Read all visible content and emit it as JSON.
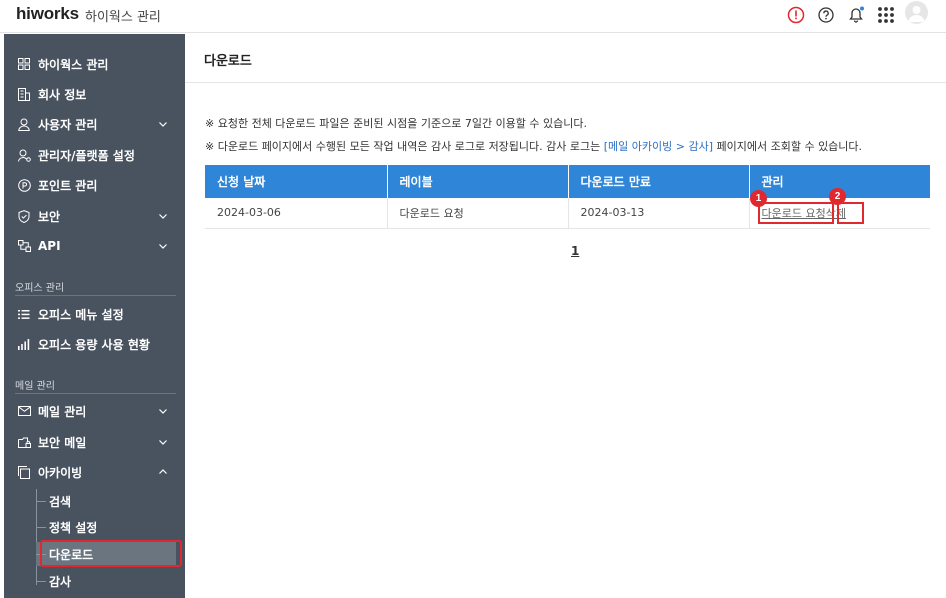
{
  "header": {
    "logo": "hiworks",
    "subtitle": "하이웍스 관리",
    "icons": [
      "alert-icon",
      "help-icon",
      "bell-icon",
      "apps-grid-icon",
      "avatar"
    ],
    "accent_red": "#e0282e"
  },
  "sidebar": {
    "items": [
      {
        "label": "하이웍스 관리",
        "icon": "grid-icon"
      },
      {
        "label": "회사 정보",
        "icon": "building-icon"
      },
      {
        "label": "사용자 관리",
        "icon": "user-icon"
      },
      {
        "label": "관리자/플랫폼 설정",
        "icon": "admin-user-icon"
      },
      {
        "label": "포인트 관리",
        "icon": "point-icon"
      },
      {
        "label": "보안",
        "icon": "shield-icon"
      },
      {
        "label": "API",
        "icon": "api-icon"
      }
    ],
    "office_section": "오피스 관리",
    "office_items": [
      {
        "label": "오피스 메뉴 설정",
        "icon": "list-icon"
      },
      {
        "label": "오피스 용량 사용 현황",
        "icon": "bar-chart-icon"
      }
    ],
    "mail_section": "메일 관리",
    "mail_items": [
      {
        "label": "메일 관리",
        "icon": "mail-icon"
      },
      {
        "label": "보안 메일",
        "icon": "secure-mail-icon"
      },
      {
        "label": "아카이빙",
        "icon": "archive-icon"
      }
    ],
    "archive_sub": [
      {
        "label": "검색"
      },
      {
        "label": "정책 설정"
      },
      {
        "label": "다운로드",
        "active": true
      },
      {
        "label": "감사"
      }
    ],
    "bg_color": "#495360"
  },
  "main": {
    "title": "다운로드",
    "notice1": "※ 요청한 전체 다운로드 파일은 준비된 시점을 기준으로 7일간 이용할 수 있습니다.",
    "notice2_pre": "※ 다운로드 페이지에서 수행된 모든 작업 내역은 감사 로그로 저장됩니다. 감사 로그는 ",
    "notice2_link": "[메일 아카이빙 > 감사]",
    "notice2_post": " 페이지에서 조회할 수 있습니다.",
    "table": {
      "headers": [
        "신청 날짜",
        "레이블",
        "다운로드 만료",
        "관리"
      ],
      "rows": [
        {
          "date": "2024-03-06",
          "label": "다운로드 요청",
          "expire": "2024-03-13",
          "action_download": "다운로드 요청",
          "action_delete": "삭제"
        }
      ],
      "header_color": "#2f86d8"
    },
    "markers": [
      "1",
      "2"
    ],
    "page": "1"
  }
}
